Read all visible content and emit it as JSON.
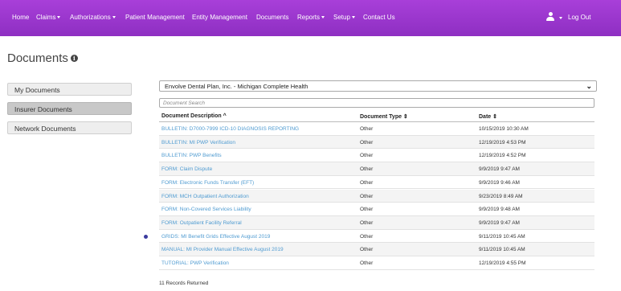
{
  "nav": {
    "items": [
      {
        "label": "Home",
        "dropdown": false
      },
      {
        "label": "Claims",
        "dropdown": true
      },
      {
        "label": "Authorizations",
        "dropdown": true
      },
      {
        "label": "Patient Management",
        "dropdown": false
      },
      {
        "label": "Entity Management",
        "dropdown": false
      },
      {
        "label": "Documents",
        "dropdown": false
      },
      {
        "label": "Reports",
        "dropdown": true
      },
      {
        "label": "Setup",
        "dropdown": true
      },
      {
        "label": "Contact Us",
        "dropdown": false
      }
    ],
    "logout_label": "Log Out",
    "user_icon": "user-icon",
    "background_color": "#9b37d0"
  },
  "page": {
    "title": "Documents",
    "info_icon_glyph": "i"
  },
  "sidebar": {
    "items": [
      {
        "label": "My Documents",
        "active": false
      },
      {
        "label": "Insurer Documents",
        "active": true
      },
      {
        "label": "Network Documents",
        "active": false
      }
    ]
  },
  "plan_select": {
    "value": "Envolve Dental Plan, Inc. - Michigan Complete Health"
  },
  "search": {
    "placeholder": "Document Search"
  },
  "table": {
    "headers": {
      "description": "Document Description ^",
      "type": "Document Type ⇕",
      "date": "Date ⇕"
    },
    "rows": [
      {
        "description": "BULLETIN: D7000-7999 ICD-10 DIAGNOSIS REPORTING",
        "type": "Other",
        "date": "10/15/2019 10:30 AM"
      },
      {
        "description": "BULLETIN: MI PWP Verification",
        "type": "Other",
        "date": "12/19/2019 4:53 PM"
      },
      {
        "description": "BULLETIN: PWP Benefits",
        "type": "Other",
        "date": "12/19/2019 4:52 PM"
      },
      {
        "description": "FORM: Claim Dispute",
        "type": "Other",
        "date": "9/9/2019 9:47 AM"
      },
      {
        "description": "FORM: Electronic Funds Transfer (EFT)",
        "type": "Other",
        "date": "9/9/2019 9:46 AM"
      },
      {
        "description": "FORM: MCH Outpatient Authorization",
        "type": "Other",
        "date": "9/23/2019 8:49 AM"
      },
      {
        "description": "FORM: Non-Covered Services Liability",
        "type": "Other",
        "date": "9/9/2019 9:48 AM"
      },
      {
        "description": "FORM: Outpatient Facility Referral",
        "type": "Other",
        "date": "9/9/2019 9:47 AM"
      },
      {
        "description": "GRIDS: MI Benefit Grids Effective August 2019",
        "type": "Other",
        "date": "9/11/2019 10:45 AM"
      },
      {
        "description": "MANUAL: MI Provider Manual Effective August 2019",
        "type": "Other",
        "date": "9/11/2019 10:45 AM"
      },
      {
        "description": "TUTORIAL: PWP Verification",
        "type": "Other",
        "date": "12/19/2019 4:55 PM"
      }
    ],
    "footer": "11 Records Returned",
    "link_color": "#4f9bd1"
  }
}
